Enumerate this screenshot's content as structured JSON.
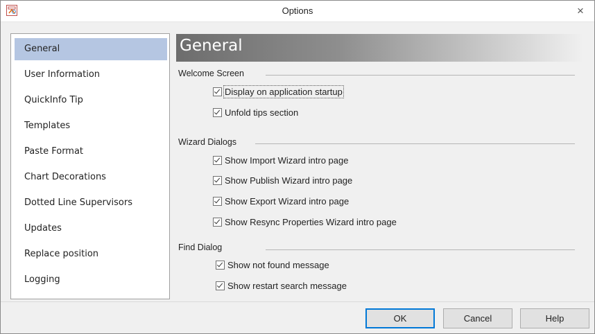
{
  "window": {
    "title": "Options",
    "close_glyph": "×",
    "icon": "app-options-icon"
  },
  "nav": {
    "items": [
      {
        "label": "General",
        "selected": true
      },
      {
        "label": "User Information",
        "selected": false
      },
      {
        "label": "QuickInfo Tip",
        "selected": false
      },
      {
        "label": "Templates",
        "selected": false
      },
      {
        "label": "Paste Format",
        "selected": false
      },
      {
        "label": "Chart Decorations",
        "selected": false
      },
      {
        "label": "Dotted Line Supervisors",
        "selected": false
      },
      {
        "label": "Updates",
        "selected": false
      },
      {
        "label": "Replace position",
        "selected": false
      },
      {
        "label": "Logging",
        "selected": false
      }
    ],
    "selected_color": "#b5c6e2"
  },
  "page": {
    "title": "General",
    "sections": [
      {
        "label": "Welcome Screen",
        "options": [
          {
            "label": "Display on application startup",
            "checked": true
          },
          {
            "label": "Unfold tips section",
            "checked": true
          }
        ]
      },
      {
        "label": "Wizard Dialogs",
        "options": [
          {
            "label": "Show Import Wizard intro page",
            "checked": true
          },
          {
            "label": "Show Publish Wizard intro page",
            "checked": true
          },
          {
            "label": "Show Export Wizard intro page",
            "checked": true
          },
          {
            "label": "Show Resync Properties Wizard intro page",
            "checked": true
          }
        ]
      },
      {
        "label": "Find Dialog",
        "options": [
          {
            "label": "Show not found message",
            "checked": true
          },
          {
            "label": "Show restart search message",
            "checked": true
          }
        ]
      }
    ]
  },
  "buttons": {
    "ok": "OK",
    "cancel": "Cancel",
    "help": "Help"
  },
  "colors": {
    "default_button_border": "#0078d7"
  }
}
